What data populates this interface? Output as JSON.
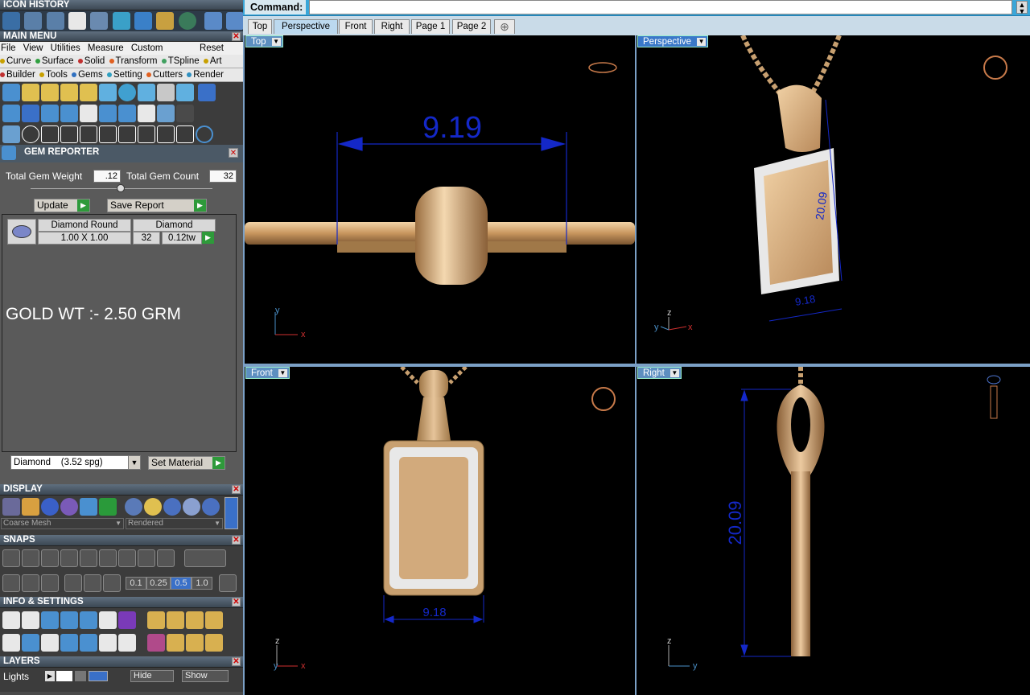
{
  "sidebar": {
    "icon_history_title": "ICON HISTORY",
    "main_menu_title": "MAIN MENU",
    "main_menu_items": [
      "File",
      "View",
      "Utilities",
      "Measure",
      "Custom"
    ],
    "reset_label": "Reset",
    "menu_row1": [
      "Curve",
      "Surface",
      "Solid",
      "Transform",
      "TSpline",
      "Art"
    ],
    "menu_row2": [
      "Builder",
      "Tools",
      "Gems",
      "Setting",
      "Cutters",
      "Render"
    ],
    "gem_reporter": {
      "title": "GEM REPORTER",
      "total_weight_label": "Total Gem Weight",
      "total_weight_value": ".12",
      "total_count_label": "Total Gem Count",
      "total_count_value": "32",
      "update_label": "Update",
      "save_report_label": "Save Report",
      "row": {
        "name": "Diamond Round",
        "material": "Diamond",
        "size": "1.00 X 1.00",
        "count": "32",
        "weight": "0.12tw"
      },
      "note": "GOLD WT :- 2.50 GRM",
      "material_select": "Diamond    (3.52 spg)",
      "set_material_label": "Set Material"
    },
    "display_title": "DISPLAY",
    "display_mesh": "Coarse Mesh",
    "display_render": "Rendered",
    "snaps_title": "SNAPS",
    "snap_values": [
      "0.1",
      "0.25",
      "0.5",
      "1.0"
    ],
    "info_title": "INFO & SETTINGS",
    "layers_title": "LAYERS",
    "layer_name": "Lights",
    "hide_label": "Hide",
    "show_label": "Show"
  },
  "command": {
    "label": "Command:"
  },
  "tabs": [
    "Top",
    "Perspective",
    "Front",
    "Right",
    "Page 1",
    "Page 2"
  ],
  "tab_add_icon": "plus-icon",
  "viewports": {
    "top": {
      "label": "Top",
      "dimension": "9.19"
    },
    "perspective": {
      "label": "Perspective",
      "dimension_height": "20.09",
      "dimension_width": "9.18"
    },
    "front": {
      "label": "Front",
      "dimension": "9.18"
    },
    "right": {
      "label": "Right",
      "dimension": "20.09"
    }
  },
  "colors": {
    "gold": "#c8a070",
    "dimension": "#1428c8",
    "axis_x": "#d03030",
    "axis_y": "#4a90c8"
  }
}
